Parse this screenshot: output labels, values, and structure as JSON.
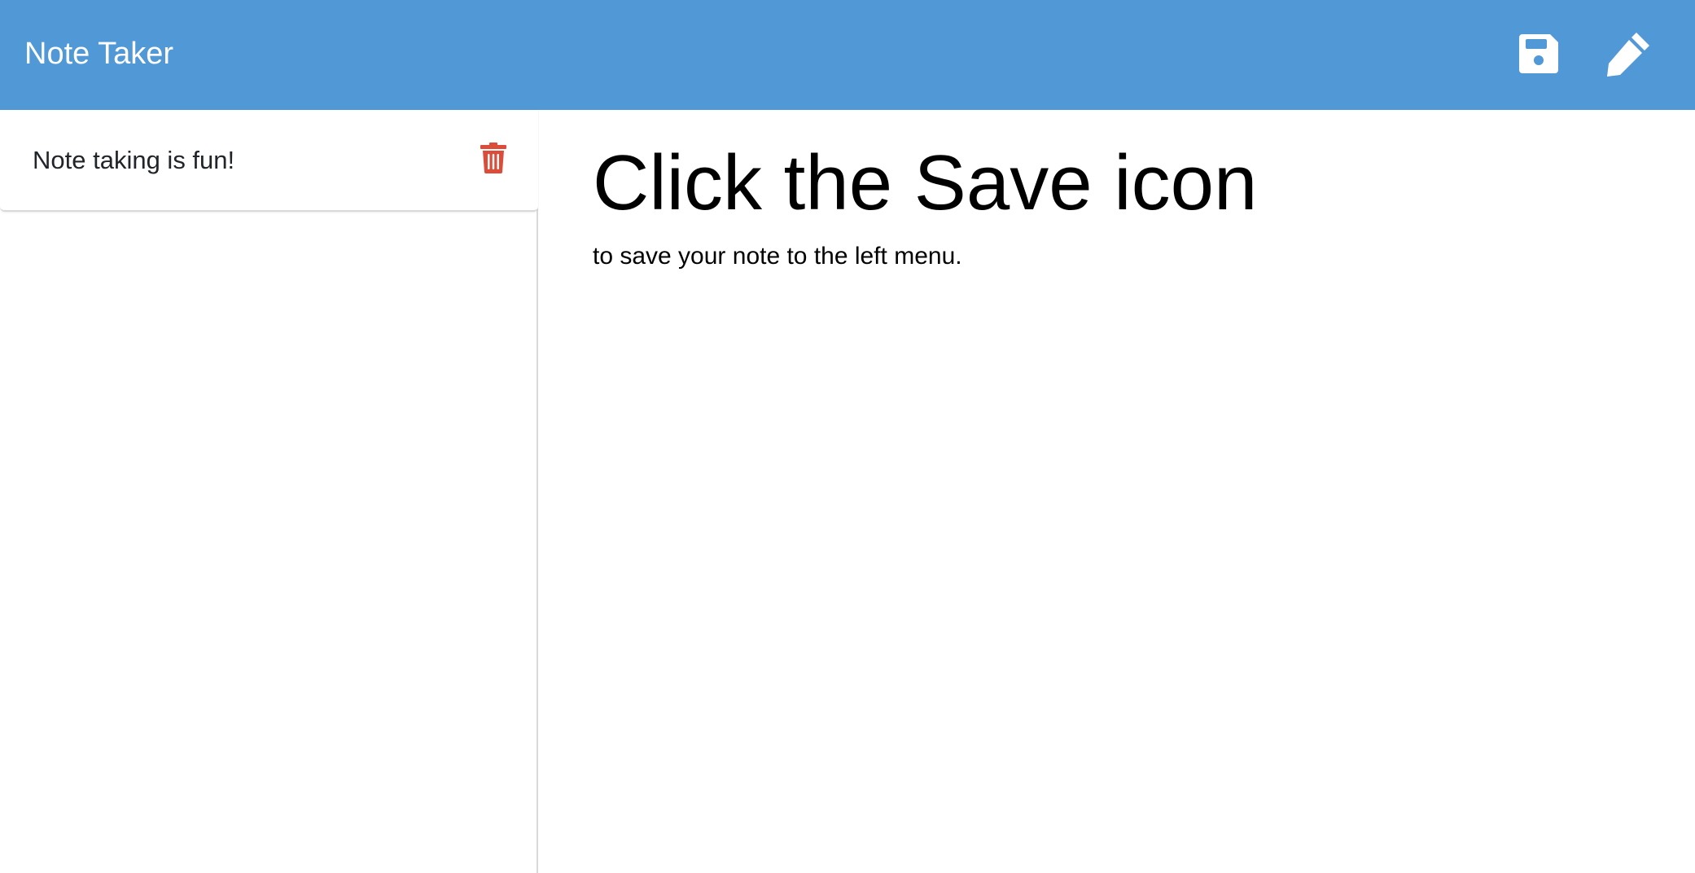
{
  "app": {
    "title": "Note Taker"
  },
  "toolbar": {
    "save_icon": "floppy-disk-icon",
    "new_note_icon": "pencil-icon"
  },
  "sidebar": {
    "notes": [
      {
        "title": "Note taking is fun!",
        "delete_icon": "trash-icon"
      }
    ]
  },
  "main": {
    "note_title": "Click the Save icon",
    "note_text": "to save your note to the left menu."
  },
  "colors": {
    "navbar": "#5098d6",
    "icon_light": "#ffffff",
    "delete": "#dd4b39"
  }
}
